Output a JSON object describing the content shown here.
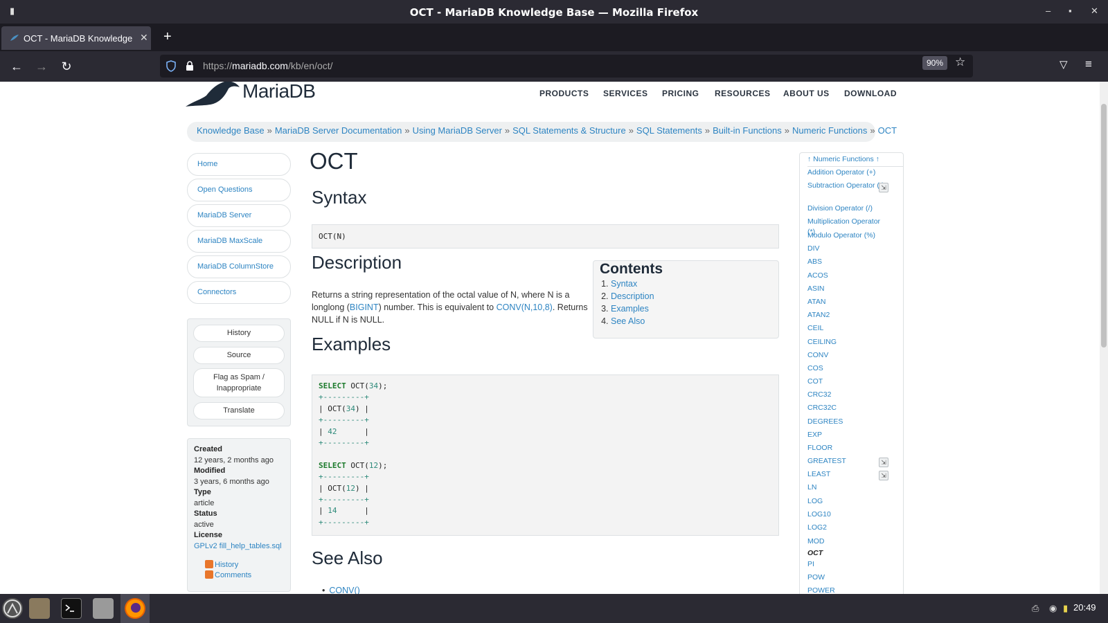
{
  "window": {
    "title": "OCT - MariaDB Knowledge Base — Mozilla Firefox"
  },
  "tab": {
    "label": "OCT - MariaDB Knowledge Base"
  },
  "address": {
    "host_prefix": "https://",
    "host": "mariadb.com",
    "path": "/kb/en/oct/",
    "zoom": "90%"
  },
  "site": {
    "logo_text": "MariaDB",
    "nav": [
      "PRODUCTS",
      "SERVICES",
      "PRICING",
      "RESOURCES",
      "ABOUT US",
      "DOWNLOAD"
    ]
  },
  "breadcrumb": [
    "Knowledge Base",
    "MariaDB Server Documentation",
    "Using MariaDB Server",
    "SQL Statements & Structure",
    "SQL Statements",
    "Built-in Functions",
    "Numeric Functions",
    "OCT"
  ],
  "breadcrumb_sep": "»",
  "left_nav": [
    "Home",
    "Open Questions",
    "MariaDB Server",
    "MariaDB MaxScale",
    "MariaDB ColumnStore",
    "Connectors"
  ],
  "actions": {
    "history": "History",
    "source": "Source",
    "flag_line1": "Flag as Spam /",
    "flag_line2": "Inappropriate",
    "translate": "Translate"
  },
  "meta": {
    "created_label": "Created",
    "created": "12 years, 2 months ago",
    "modified_label": "Modified",
    "modified": "3 years, 6 months ago",
    "type_label": "Type",
    "type": "article",
    "status_label": "Status",
    "status": "active",
    "license_label": "License",
    "license": "GPLv2 fill_help_tables.sql",
    "feed_history": "History",
    "feed_comments": "Comments"
  },
  "article": {
    "title": "OCT",
    "syntax_heading": "Syntax",
    "syntax": "OCT(N)",
    "description_heading": "Description",
    "desc_part1": "Returns a string representation of the octal value of N, where N is a longlong (",
    "desc_link1": "BIGINT",
    "desc_part2": ") number. This is equivalent to ",
    "desc_link2": "CONV(N,10,8)",
    "desc_part3": ". Returns NULL if N is NULL.",
    "examples_heading": "Examples",
    "see_also_heading": "See Also",
    "see_also": [
      "CONV()"
    ]
  },
  "code": {
    "kw": "SELECT",
    "fn": "OCT(",
    "q1_arg": "34",
    "q1_end": ");",
    "border": "+---------+",
    "q1_head_pre": "| OCT(",
    "q1_head_arg": "34",
    "q1_head_post": ") |",
    "q1_row_pre": "| ",
    "q1_val": "42",
    "q1_row_post": "      |",
    "q2_arg": "12",
    "q2_end": ");",
    "q2_head_pre": "| OCT(",
    "q2_head_arg": "12",
    "q2_head_post": ") |",
    "q2_row_pre": "| ",
    "q2_val": "14",
    "q2_row_post": "      |"
  },
  "toc": {
    "title": "Contents",
    "items": [
      "Syntax",
      "Description",
      "Examples",
      "See Also"
    ]
  },
  "right_nav": {
    "parent": "↑ Numeric Functions ↑",
    "items": [
      "Addition Operator (+)",
      "Subtraction Operator (-)",
      "Division Operator (/)",
      "Multiplication Operator (*)",
      "Modulo Operator (%)",
      "DIV",
      "ABS",
      "ACOS",
      "ASIN",
      "ATAN",
      "ATAN2",
      "CEIL",
      "CEILING",
      "CONV",
      "COS",
      "COT",
      "CRC32",
      "CRC32C",
      "DEGREES",
      "EXP",
      "FLOOR",
      "GREATEST",
      "LEAST",
      "LN",
      "LOG",
      "LOG10",
      "LOG2",
      "MOD",
      "OCT",
      "PI",
      "POW",
      "POWER"
    ]
  },
  "clock": "20:49",
  "colors": {
    "link": "#2d84c2",
    "chrome": "#2b2a33",
    "code_kw": "#1c7a2c",
    "code_num": "#2d8a7a"
  }
}
